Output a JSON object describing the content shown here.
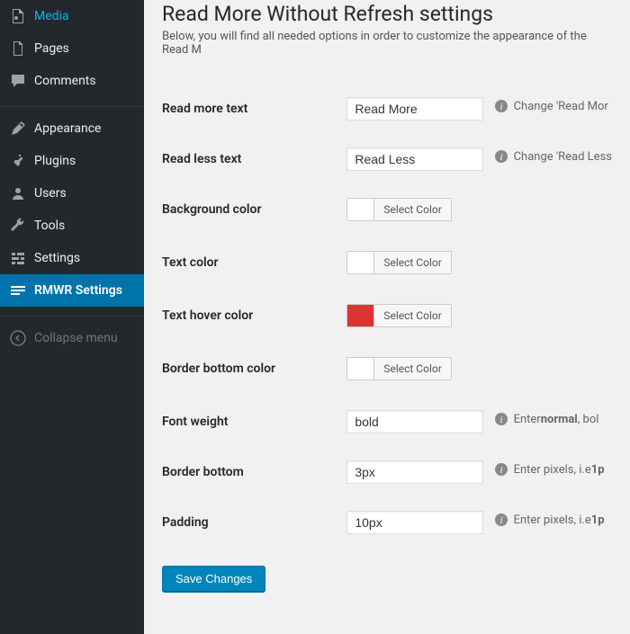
{
  "sidebar": {
    "items": [
      {
        "label": "Media"
      },
      {
        "label": "Pages"
      },
      {
        "label": "Comments"
      },
      {
        "label": "Appearance"
      },
      {
        "label": "Plugins"
      },
      {
        "label": "Users"
      },
      {
        "label": "Tools"
      },
      {
        "label": "Settings"
      },
      {
        "label": "RMWR Settings"
      }
    ],
    "collapse": "Collapse menu"
  },
  "page": {
    "title": "Read More Without Refresh settings",
    "subhead": "Below, you will find all needed options in order to customize the appearance of the Read M"
  },
  "fields": {
    "read_more_label": "Read more text",
    "read_more_value": "Read More",
    "read_more_hint": "Change 'Read Mor",
    "read_less_label": "Read less text",
    "read_less_value": "Read Less",
    "read_less_hint": "Change 'Read Less",
    "bg_color_label": "Background color",
    "text_color_label": "Text color",
    "hover_color_label": "Text hover color",
    "border_color_label": "Border bottom color",
    "select_color": "Select Color",
    "font_weight_label": "Font weight",
    "font_weight_value": "bold",
    "font_weight_hint": "Enter ",
    "font_weight_hint2": "normal",
    "font_weight_hint3": " , bol",
    "border_bottom_label": "Border bottom",
    "border_bottom_value": "3px",
    "pixels_hint": "Enter pixels, i.e ",
    "pixels_hint_bold": "1p",
    "padding_label": "Padding",
    "padding_value": "10px",
    "submit": "Save Changes"
  }
}
